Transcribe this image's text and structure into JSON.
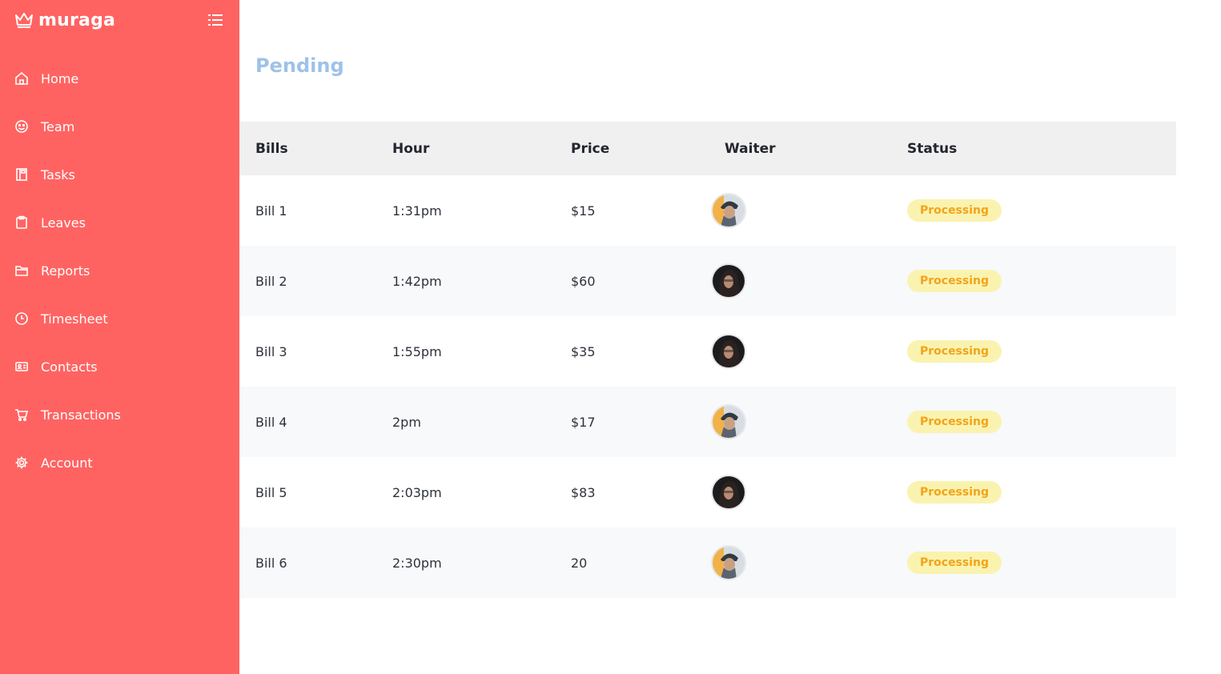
{
  "brand": {
    "name": "muraga",
    "icon": "crown-icon"
  },
  "colors": {
    "sidebar": "#ff6361",
    "title": "#9ec2e9",
    "badge_bg": "#faf3b0",
    "badge_text": "#f2a41a"
  },
  "sidebar": {
    "items": [
      {
        "label": "Home",
        "icon": "home-icon"
      },
      {
        "label": "Team",
        "icon": "smile-icon"
      },
      {
        "label": "Tasks",
        "icon": "book-icon"
      },
      {
        "label": "Leaves",
        "icon": "clipboard-icon"
      },
      {
        "label": "Reports",
        "icon": "folder-icon"
      },
      {
        "label": "Timesheet",
        "icon": "clock-icon"
      },
      {
        "label": "Contacts",
        "icon": "contact-card-icon"
      },
      {
        "label": "Transactions",
        "icon": "cart-icon"
      },
      {
        "label": "Account",
        "icon": "gear-icon"
      }
    ]
  },
  "main": {
    "title": "Pending",
    "table": {
      "headers": [
        "Bills",
        "Hour",
        "Price",
        "Waiter",
        "Status"
      ],
      "rows": [
        {
          "bill": "Bill 1",
          "hour": "1:31pm",
          "price": "$15",
          "waiter": "avatar-man-beanie",
          "status": "Processing"
        },
        {
          "bill": "Bill 2",
          "hour": "1:42pm",
          "price": "$60",
          "waiter": "avatar-woman-dark",
          "status": "Processing"
        },
        {
          "bill": "Bill 3",
          "hour": "1:55pm",
          "price": "$35",
          "waiter": "avatar-woman-dark",
          "status": "Processing"
        },
        {
          "bill": "Bill 4",
          "hour": "2pm",
          "price": "$17",
          "waiter": "avatar-man-beanie",
          "status": "Processing"
        },
        {
          "bill": "Bill 5",
          "hour": "2:03pm",
          "price": "$83",
          "waiter": "avatar-woman-dark",
          "status": "Processing"
        },
        {
          "bill": "Bill 6",
          "hour": "2:30pm",
          "price": "20",
          "waiter": "avatar-man-beanie",
          "status": "Processing"
        }
      ]
    }
  }
}
